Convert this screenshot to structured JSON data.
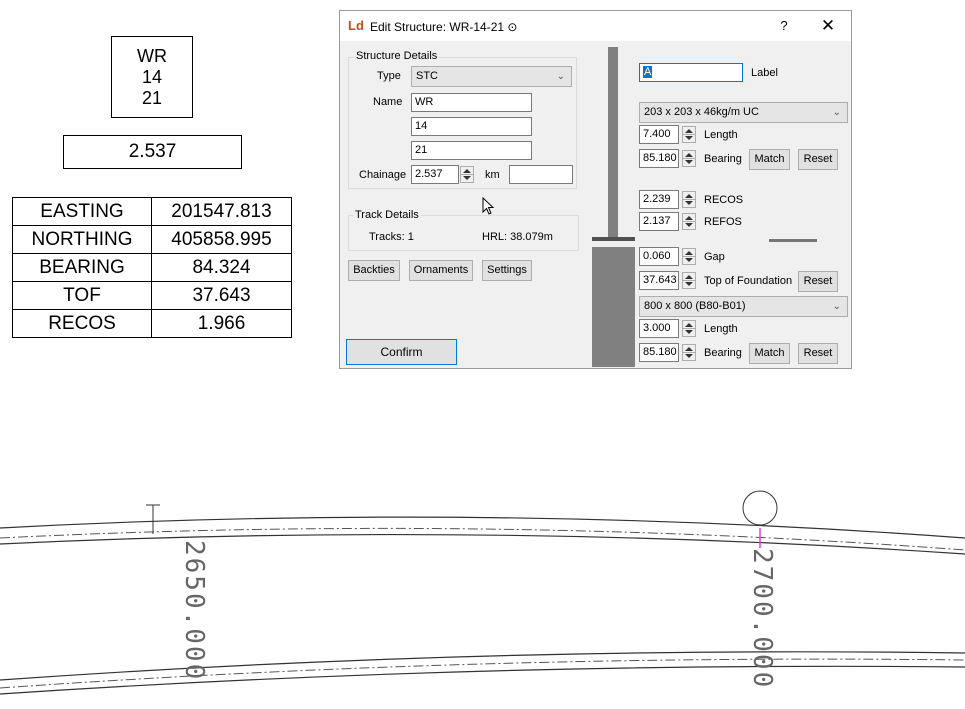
{
  "label_block": {
    "lines": [
      "WR",
      "14",
      "21"
    ],
    "chainage": "2.537"
  },
  "info_table": [
    {
      "key": "EASTING",
      "value": "201547.813"
    },
    {
      "key": "NORTHING",
      "value": "405858.995"
    },
    {
      "key": "BEARING",
      "value": "84.324"
    },
    {
      "key": "TOF",
      "value": "37.643"
    },
    {
      "key": "RECOS",
      "value": "1.966"
    }
  ],
  "dialog": {
    "app_icon": "Ld",
    "title": "Edit Structure: WR-14-21 ⊙",
    "help": "?",
    "close": "✕",
    "structure_details": {
      "group_label": "Structure Details",
      "type_label": "Type",
      "type_value": "STC",
      "name_label": "Name",
      "name_values": [
        "WR",
        "14",
        "21"
      ],
      "chainage_label": "Chainage",
      "chainage_value": "2.537",
      "chainage_unit": "km",
      "chainage_extra": ""
    },
    "track_details": {
      "group_label": "Track Details",
      "tracks": "Tracks:  1",
      "hrl": "HRL:  38.079m"
    },
    "buttons": {
      "backties": "Backties",
      "ornaments": "Ornaments",
      "settings": "Settings",
      "confirm": "Confirm"
    },
    "right": {
      "label_value": "A",
      "label_caption": "Label",
      "section_upper": "203 x 203 x 46kg/m UC",
      "upper_length": "7.400",
      "length_caption": "Length",
      "upper_bearing": "85.180",
      "bearing_caption": "Bearing",
      "match": "Match",
      "reset": "Reset",
      "recos_value": "2.239",
      "recos_caption": "RECOS",
      "refos_value": "2.137",
      "refos_caption": "REFOS",
      "gap_value": "0.060",
      "gap_caption": "Gap",
      "tof_value": "37.643",
      "tof_caption": "Top of Foundation",
      "section_lower": "800 x 800 (B80-B01)",
      "lower_length": "3.000",
      "lower_bearing": "85.180"
    }
  },
  "drawing": {
    "chainage_left": "2650.000",
    "chainage_right": "2700.000"
  },
  "colors": {
    "accent": "#0078d7",
    "window_bg": "#f0f0f0",
    "diagram_bar": "#808080",
    "marker": "#e040e0"
  }
}
